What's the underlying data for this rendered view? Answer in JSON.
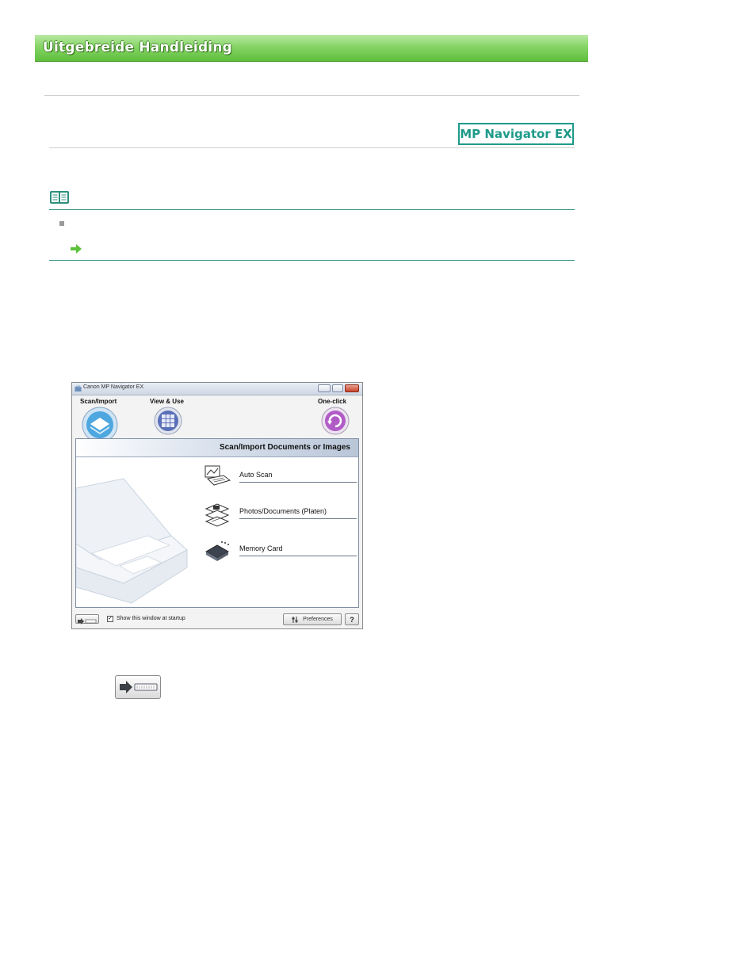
{
  "header": {
    "title": "Uitgebreide Handleiding",
    "banner_color": "#6cc84a"
  },
  "product_badge": {
    "label": "MP Navigator EX",
    "color": "#1f9a8a"
  },
  "note": {
    "icon": "book-icon",
    "bullet": "square-bullet-icon",
    "link_icon": "green-arrow-icon"
  },
  "app_window": {
    "title": "Canon MP Navigator EX",
    "nav": [
      {
        "label": "Scan/Import",
        "icon": "scan-import-icon"
      },
      {
        "label": "View & Use",
        "icon": "view-use-icon"
      },
      {
        "label": "One-click",
        "icon": "one-click-icon"
      }
    ],
    "panel_title": "Scan/Import Documents or Images",
    "options": [
      {
        "label": "Auto Scan",
        "icon": "auto-scan-icon"
      },
      {
        "label": "Photos/Documents (Platen)",
        "icon": "photos-documents-icon"
      },
      {
        "label": "Memory Card",
        "icon": "memory-card-icon"
      }
    ],
    "footer": {
      "show_at_startup_label": "Show this window at startup",
      "show_at_startup_checked": true,
      "preferences_label": "Preferences",
      "help_label": "?"
    }
  },
  "arrow_button": {
    "icon": "arrow-right-icon"
  }
}
